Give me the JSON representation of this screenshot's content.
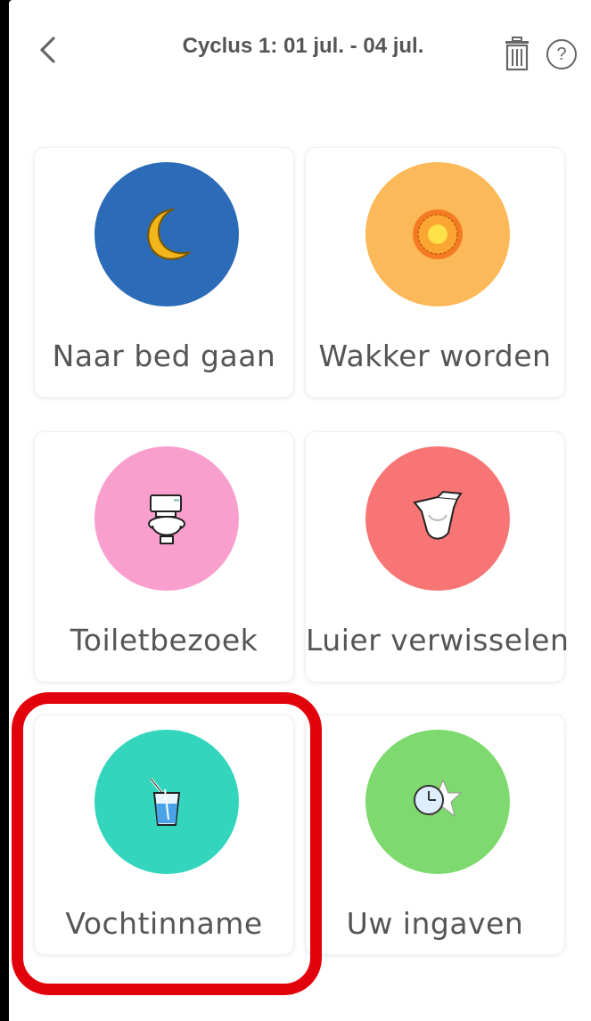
{
  "header": {
    "title": "Cyclus 1: 01 jul. - 04 jul.",
    "back_icon": "chevron-left-icon",
    "trash_icon": "trash-icon",
    "help_label": "?"
  },
  "tiles": [
    {
      "label": "Naar bed gaan",
      "icon": "moon-icon",
      "color": "#2c6bb8"
    },
    {
      "label": "Wakker worden",
      "icon": "sun-icon",
      "color": "#fbb959"
    },
    {
      "label": "Toiletbezoek",
      "icon": "toilet-icon",
      "color": "#f99fce"
    },
    {
      "label": "Luier verwisselen",
      "icon": "diaper-icon",
      "color": "#f77575"
    },
    {
      "label": "Vochtinname",
      "icon": "drink-glass-icon",
      "color": "#33d6bd"
    },
    {
      "label": "Uw ingaven",
      "icon": "clock-star-icon",
      "color": "#7ed96e"
    }
  ],
  "highlight": {
    "color": "#e2020b",
    "target": "Vochtinname"
  }
}
